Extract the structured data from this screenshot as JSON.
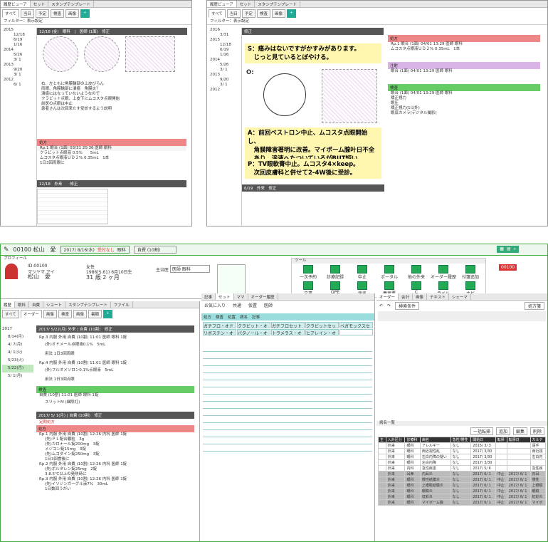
{
  "top_left": {
    "tabs": [
      "履歴ビューア",
      "セット",
      "スタンプテンプレート"
    ],
    "subtabs": [
      "すべて",
      "当日",
      "予定",
      "検査",
      "画像"
    ],
    "filter": "フィルター：表示設定",
    "tree": [
      "2015",
      "12/18",
      "6/19",
      "1/16",
      "2014",
      "5/26",
      "3/ 1",
      "2013",
      "9/20",
      "3/ 1",
      "2012",
      "6/ 1"
    ],
    "rec_header": "12/18 (金)　眼科　|　医師 (1面)　修正",
    "note_lines": [
      "右、左ともに角膜輪部の上皮びらん",
      "両眼、角膜輪部に潰瘍　角膜炎？",
      "潰瘍にはなっていないようなので",
      "クラビット点眼、上皮下にムコスタ点眼開始",
      "前医の点眼は中止",
      "",
      "患者さんは次回来たす受診するよう説明"
    ],
    "rx_title": "処方",
    "rx_row": "Rp.1 眼合 (1面) 03/31 20:36 医師 眼科",
    "rx_items": [
      "クラビット点眼液 0.5%　　5mL",
      "ムコスタ点眼液ＵＤ２% 0.35mL　1本",
      "1日3回両眼に"
    ],
    "bottom_hdr": "12/18　外来　　修正"
  },
  "top_right": {
    "tabs": [
      "履歴ビューア",
      "セット",
      "スタンプテンプレート"
    ],
    "subtabs": [
      "すべて",
      "当日",
      "予定",
      "検査",
      "画像"
    ],
    "filter": "フィルター：表示設定",
    "tree": [
      "2016",
      "3/31",
      "2015",
      "12/18",
      "6/19",
      "1/16",
      "2014",
      "5/26",
      "3/ 1",
      "2013",
      "9/20",
      "3/ 1",
      "2012"
    ],
    "S": "S：痛みはないですがかすみがあります。\n　じっと見ているとぼやける。",
    "O": "O:",
    "A": "A：前回ベストロン中止、ムコスタ点眼開始し、\n　角膜障害著明に改善。マイボーム腺叶日不全\n　あり、涙液へたついているがBUT短い。",
    "P": "P：TV眼軟膏中止。ムコスタ4×keep。\n　次回皮膚科と併せて2-4W後に受診。",
    "rx_title": "処方",
    "rx_row": "Rp.1 眼合 (1面) 04/01 13:29 医師 眼科",
    "rx_item": "ムコスタ点眼液ＵＤ２% 0.35mL　1本",
    "inj_title": "注射",
    "inj_row": "眼合 (1面) 04/01 13:29 医師 眼科",
    "exam_title": "検査",
    "exam_row": "眼合 (1面) 04/01 13:29 医師 眼科",
    "exam_items": [
      "矯正視力",
      "眼圧",
      "矯正視力(1以外)",
      "眼底カメラ(デジタル撮影)"
    ],
    "bottom_hdr": "6/19　外来　修正"
  },
  "main": {
    "patient": "00100 松山　愛",
    "date": "2017/ 8/16(水)",
    "status": "受付なし",
    "dept": "眼科",
    "doc": "自費 (10割)",
    "profile": "プロフィール",
    "id": "ID:00100",
    "kana": "マツヤマ アイ",
    "name": "松山　愛",
    "sex": "女性",
    "dob": "1986(S.61) 6月10日生",
    "age": "31 歳 2 ヶ月",
    "care": "主治医",
    "care_val": "医師 眼科",
    "tool_label": "ツール",
    "tools": [
      "一次予約",
      "診療記録",
      "中止",
      "ポータル",
      "他の外来",
      "オーダー履歴",
      "付箋追加",
      "文書",
      "OPE",
      "病名",
      "患者票",
      "C",
      "ラベル",
      "ナビ"
    ],
    "left_tabs": [
      "すべて",
      "オーダー",
      "画像",
      "検査",
      "画像",
      "書類"
    ],
    "left_top_tabs": [
      "履歴",
      "眼科",
      "自費",
      "ショート",
      "スタンプテンプレート",
      "ファイル"
    ],
    "tree": [
      "2017",
      "8/14(月)",
      "4/ 7(月)",
      "4/ 1(火)",
      "5/23(火)",
      "5/22(月)",
      "5/ 1(月)"
    ],
    "rec1_hdr": "2017/ 5/22(月) 外来 | 自費 (10割)　修正",
    "rec1_lines": [
      "Rp.3 内服 外用 自費 (10割) 11:01 医師 眼科 1錠",
      "(外)オドメール点眼液0.1%　5mL",
      "用法 1日3回両眼",
      "Rp.4 内服 外用 自費 (10割) 11:01 医師 眼科 1錠",
      "(外)フルオメソロン0.1%点眼液　5mL",
      "用法 1日3回点眼"
    ],
    "exam_title": "検査",
    "exam_line": "自費 (10割) 11:01 医師 眼科 1錠",
    "exam_item": "スリットM (細隙灯)",
    "rec2_hdr": "2017/ 5/ 1(月) | 自費 (10割)　修正",
    "rec2_sub": "定期処方",
    "rec2_title": "処方",
    "rec2_lines": [
      "Rp.1 内服 外用 自費 (10割) 12:26 内科 医師 1錠",
      "(先)ＰＬ配合顆粒　3g",
      "(先)カロナール錠200mg　3錠",
      "メジコン錠15mg　3錠",
      "(先)ムコダイン錠250mg　3錠",
      "1日3回食後に",
      "Rp.2 内服 外用 自費 (10割) 12:26 内科 医師 1錠",
      "(先)ボルタレン錠25mg　2錠",
      "3.8.5℃以上の発熱時に",
      "Rp.3 内服 外用 自費 (10割) 12:26 内科 医師 1錠",
      "(先)イソジンガーグル液7%　30mL",
      "1日数回うがい"
    ],
    "mid_tabs": [
      "記事",
      "セット",
      "ママ",
      "オーダー履歴"
    ],
    "mid_sub": [
      "お気に入り",
      "共通",
      "仮置",
      "医師"
    ],
    "mid_cat": [
      "処方",
      "検査",
      "処置",
      "病名",
      "記事"
    ],
    "mid_grid": [
      "ガチフロ・オド",
      "クラビット・オ",
      "ガチフロセット",
      "クラビットセット",
      "ベガモックスセ",
      "リボスチン・オ",
      "パタノール・オ",
      "トラメラス・オ",
      "ヒアレイン・オ"
    ],
    "right_tabs": [
      "オーダー",
      "会計",
      "画像",
      "テキスト",
      "シェーマ"
    ],
    "right_sub": "検索条件",
    "right_btn": "処方箋",
    "list_title": "病名一覧",
    "list_btns": [
      "一括転帰",
      "追加",
      "編集",
      "削除"
    ],
    "cols": [
      "主",
      "入外区分",
      "診療科",
      "病名",
      "急性/慢性",
      "開始日",
      "転帰",
      "転帰日",
      "カルテ"
    ],
    "rows": [
      [
        "",
        "外来",
        "眼科",
        "アレルギー",
        "なし",
        "2015/ 3/ 3",
        "",
        "",
        "遠手"
      ],
      [
        "",
        "外来",
        "眼科",
        "両近視性乱",
        "なし",
        "2017/ 3/30",
        "",
        "",
        "両近視"
      ],
      [
        "",
        "外来",
        "眼科",
        "右白内障の疑い",
        "なし",
        "2017/ 3/30",
        "",
        "",
        "右白内"
      ],
      [
        "",
        "外来",
        "眼科",
        "左白内障",
        "なし",
        "2017/ 3/30",
        "",
        "",
        ""
      ],
      [
        "",
        "外来",
        "内科",
        "急性疾患",
        "なし",
        "2017/ 5/ 6",
        "",
        "",
        "急性疾"
      ],
      [
        "",
        "外来",
        "耳鼻",
        "内耳炎",
        "なし",
        "2017/ 6/ 1",
        "中止",
        "2017/ 6/ 1",
        "内耳"
      ],
      [
        "",
        "外来",
        "眼科",
        "慢性結膜炎",
        "なし",
        "2017/ 6/ 1",
        "中止",
        "2017/ 6/ 1",
        "慢性"
      ],
      [
        "",
        "外来",
        "眼科",
        "上眼瞼結膜炎",
        "なし",
        "2017/ 6/ 1",
        "中止",
        "2017/ 6/ 1",
        "上眼瞼"
      ],
      [
        "",
        "外来",
        "眼科",
        "眼瞼炎",
        "なし",
        "2017/ 6/ 1",
        "中止",
        "2017/ 6/ 1",
        "眼瞼"
      ],
      [
        "",
        "外来",
        "眼科",
        "虹彩炎",
        "なし",
        "2017/ 6/ 1",
        "中止",
        "2017/ 6/ 1",
        "虹彩炎"
      ],
      [
        "",
        "外来",
        "眼科",
        "マイボーム腺",
        "なし",
        "2017/ 6/ 1",
        "中止",
        "2017/ 6/ 1",
        "マイボ"
      ]
    ]
  },
  "colors": {
    "accent": "#3b8",
    "red": "#e88",
    "purple": "#d9b4e6",
    "yellow": "#fff6b0"
  }
}
